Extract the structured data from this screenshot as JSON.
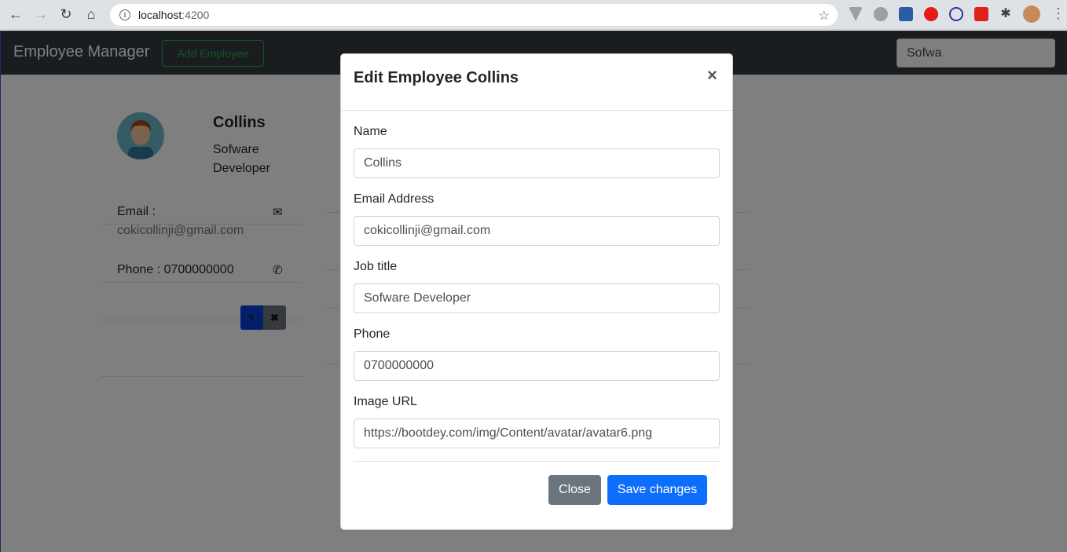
{
  "browser": {
    "url_host": "localhost",
    "url_port": ":4200"
  },
  "navbar": {
    "brand": "Employee Manager",
    "add_button": "Add Employee",
    "search_value": "Sofwa"
  },
  "card": {
    "name": "Collins",
    "job_title": "Sofware Developer",
    "email_label": "Email :",
    "email": "cokicollinji@gmail.com",
    "phone_label": "Phone : 0700000000"
  },
  "modal": {
    "title": "Edit Employee Collins",
    "close_symbol": "×",
    "fields": [
      {
        "label": "Name",
        "value": "Collins"
      },
      {
        "label": "Email Address",
        "value": "cokicollinji@gmail.com"
      },
      {
        "label": "Job title",
        "value": "Sofware Developer"
      },
      {
        "label": "Phone",
        "value": "0700000000"
      },
      {
        "label": "Image URL",
        "value": "https://bootdey.com/img/Content/avatar/avatar6.png"
      }
    ],
    "close_button": "Close",
    "save_button": "Save changes"
  },
  "colors": {
    "navbar": "#343a40",
    "primary": "#0d6efd",
    "secondary": "#6c757d",
    "success": "#28a745"
  }
}
